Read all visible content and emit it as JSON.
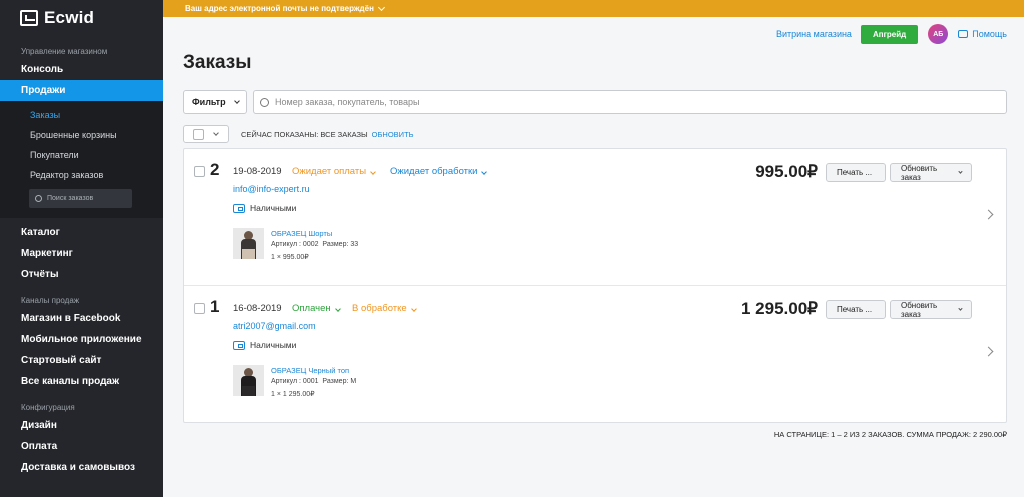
{
  "sidebar": {
    "logo_text": "Ecwid",
    "sections": {
      "store_management": "Управление магазином",
      "sales_channels": "Каналы продаж",
      "configuration": "Конфигурация"
    },
    "items": {
      "console": "Консоль",
      "sales": "Продажи",
      "catalog": "Каталог",
      "marketing": "Маркетинг",
      "reports": "Отчёты",
      "facebook_store": "Магазин в Facebook",
      "mobile_app": "Мобильное приложение",
      "starter_site": "Стартовый сайт",
      "all_channels": "Все каналы продаж",
      "design": "Дизайн",
      "payment": "Оплата",
      "delivery": "Доставка и самовывоз"
    },
    "sub_items": {
      "orders": "Заказы",
      "abandoned_carts": "Брошенные корзины",
      "customers": "Покупатели",
      "order_editor": "Редактор заказов"
    },
    "search_placeholder": "Поиск заказов"
  },
  "banner": {
    "text": "Ваш адрес электронной почты не подтверждён"
  },
  "topbar": {
    "storefront_link": "Витрина магазина",
    "upgrade_button": "Апгрейд",
    "avatar_initials": "АБ",
    "help_link": "Помощь"
  },
  "page": {
    "title": "Заказы",
    "filter_button": "Фильтр",
    "search_placeholder": "Номер заказа, покупатель, товары",
    "showing_text": "СЕЙЧАС ПОКАЗАНЫ: ВСЕ ЗАКАЗЫ",
    "refresh_link": "ОБНОВИТЬ",
    "summary": "НА СТРАНИЦЕ: 1 – 2 ИЗ 2 ЗАКАЗОВ. СУММА ПРОДАЖ: 2 290.00₽"
  },
  "orders": [
    {
      "number": "2",
      "date": "19-08-2019",
      "payment_status": "Ожидает оплаты",
      "fulfillment_status": "Ожидает обработки",
      "email": "info@info-expert.ru",
      "payment_method": "Наличными",
      "price": "995.00₽",
      "print_button": "Печать ...",
      "update_button": "Обновить заказ",
      "product": {
        "name": "ОБРАЗЕЦ Шорты",
        "sku": "Артикул : 0002",
        "option": "Размер: 33",
        "qty_line": "1 × 995.00₽"
      },
      "colors": {
        "payment_status": "#f0951f",
        "fulfillment_status": "#1a87d6"
      }
    },
    {
      "number": "1",
      "date": "16-08-2019",
      "payment_status": "Оплачен",
      "fulfillment_status": "В обработке",
      "email": "atri2007@gmail.com",
      "payment_method": "Наличными",
      "price": "1 295.00₽",
      "print_button": "Печать ...",
      "update_button": "Обновить заказ",
      "product": {
        "name": "ОБРАЗЕЦ Черный топ",
        "sku": "Артикул : 0001",
        "option": "Размер: M",
        "qty_line": "1 × 1 295.00₽"
      },
      "colors": {
        "payment_status": "#2ea43c",
        "fulfillment_status": "#f0951f"
      }
    }
  ],
  "colors": {
    "sidebar_bg": "#24262b",
    "active_item": "#1396e8",
    "banner": "#e3a11c",
    "upgrade": "#2fac3d",
    "link": "#1a87d6"
  }
}
